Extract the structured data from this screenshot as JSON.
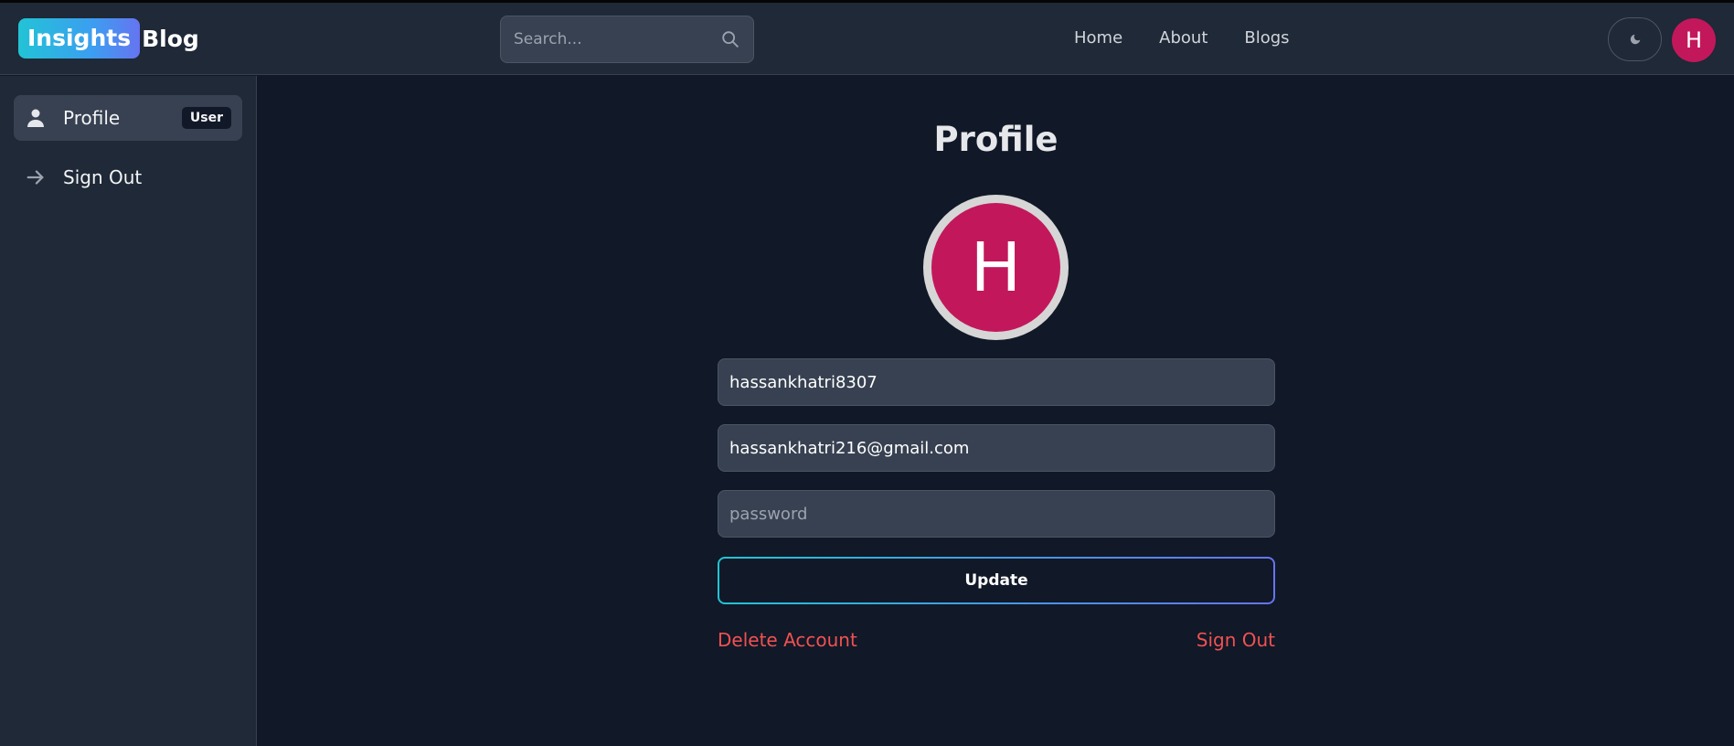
{
  "brand": {
    "badge": "Insights",
    "text": "Blog"
  },
  "search": {
    "placeholder": "Search..."
  },
  "nav": {
    "links": [
      "Home",
      "About",
      "Blogs"
    ],
    "avatar_letter": "H"
  },
  "sidebar": {
    "items": [
      {
        "label": "Profile",
        "badge": "User",
        "icon": "user-icon",
        "active": true
      },
      {
        "label": "Sign Out",
        "icon": "arrow-right-icon",
        "active": false
      }
    ]
  },
  "profile": {
    "title": "Profile",
    "avatar_letter": "H",
    "username": "hassankhatri8307",
    "email": "hassankhatri216@gmail.com",
    "password_placeholder": "password",
    "update_label": "Update",
    "delete_label": "Delete Account",
    "signout_label": "Sign Out"
  },
  "colors": {
    "background": "#111827",
    "panel": "#1f2937",
    "input": "#374151",
    "avatar": "#c2185b",
    "danger": "#f05252",
    "gradient_start": "#22c3d6",
    "gradient_end": "#6674f1"
  }
}
